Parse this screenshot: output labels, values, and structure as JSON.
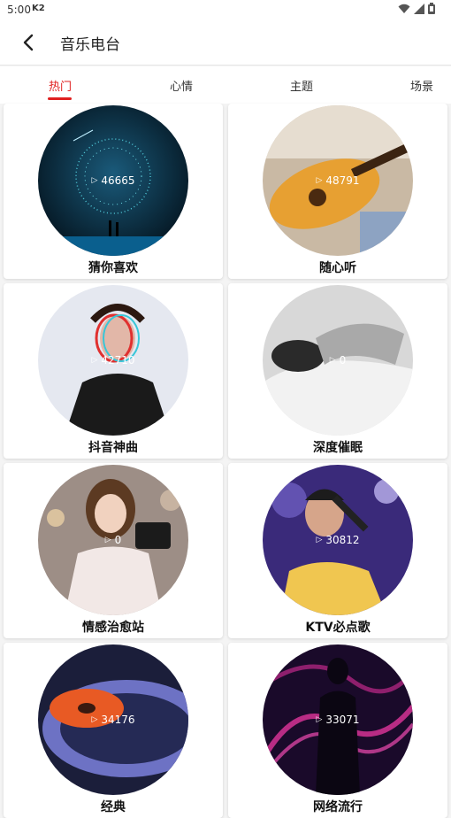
{
  "status": {
    "time": "5:00",
    "indicator": "K2"
  },
  "header": {
    "title": "音乐电台"
  },
  "tabs": [
    {
      "label": "热门"
    },
    {
      "label": "心情"
    },
    {
      "label": "主题"
    },
    {
      "label": "场景"
    }
  ],
  "stations": [
    {
      "title": "猜你喜欢",
      "plays": "46665"
    },
    {
      "title": "随心听",
      "plays": "48791"
    },
    {
      "title": "抖音神曲",
      "plays": "42710"
    },
    {
      "title": "深度催眠",
      "plays": "0"
    },
    {
      "title": "情感治愈站",
      "plays": "0"
    },
    {
      "title": "KTV必点歌",
      "plays": "30812"
    },
    {
      "title": "经典",
      "plays": "34176"
    },
    {
      "title": "网络流行",
      "plays": "33071"
    }
  ]
}
